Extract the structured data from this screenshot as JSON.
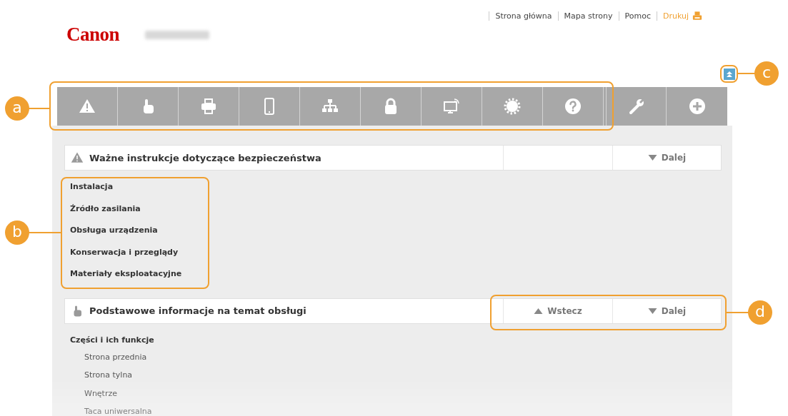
{
  "header": {
    "logo": "Canon",
    "links": [
      {
        "label": "Strona główna",
        "kind": "link"
      },
      {
        "label": "Mapa strony",
        "kind": "link"
      },
      {
        "label": "Pomoc",
        "kind": "link"
      },
      {
        "label": "Drukuj",
        "kind": "print"
      }
    ]
  },
  "sections": [
    {
      "title": "Ważne instrukcje dotyczące bezpieczeństwa",
      "kind": "warning",
      "buttons": [
        {
          "kind": "empty"
        },
        {
          "kind": "next",
          "label": "Dalej"
        }
      ],
      "links": [
        {
          "label": "Instalacja"
        },
        {
          "label": "Źródło zasilania"
        },
        {
          "label": "Obsługa urządzenia"
        },
        {
          "label": "Konserwacja i przeglądy"
        },
        {
          "label": "Materiały eksploatacyjne"
        }
      ]
    },
    {
      "title": "Podstawowe informacje na temat obsługi",
      "kind": "hand",
      "buttons": [
        {
          "kind": "prev",
          "label": "Wstecz"
        },
        {
          "kind": "next",
          "label": "Dalej"
        }
      ],
      "links": [
        {
          "label": "Części i ich funkcje",
          "children": [
            {
              "label": "Strona przednia"
            },
            {
              "label": "Strona tylna"
            },
            {
              "label": "Wnętrze"
            },
            {
              "label": "Taca uniwersalna"
            }
          ]
        }
      ]
    }
  ],
  "callouts": [
    {
      "label": "a"
    },
    {
      "label": "b"
    },
    {
      "label": "c"
    },
    {
      "label": "d"
    }
  ]
}
